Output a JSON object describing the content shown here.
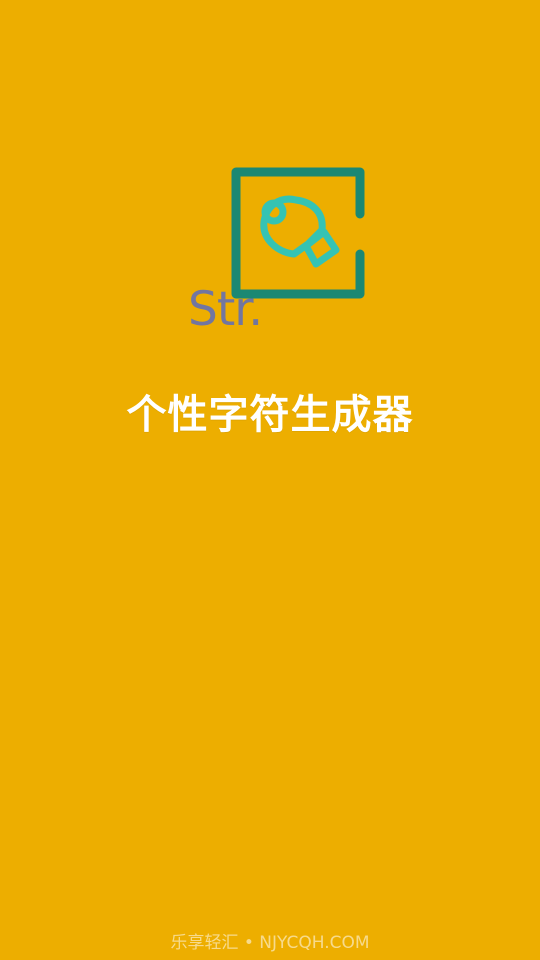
{
  "app": {
    "logo_text": "Str.",
    "title": "个性字符生成器"
  },
  "footer": {
    "watermark": "乐享轻汇 • NJYCQH.COM"
  },
  "colors": {
    "background": "#EDAE00",
    "frame": "#1B8873",
    "pen": "#35C3B3",
    "logo_text": "#7276A0",
    "title": "#FFFFFF"
  }
}
